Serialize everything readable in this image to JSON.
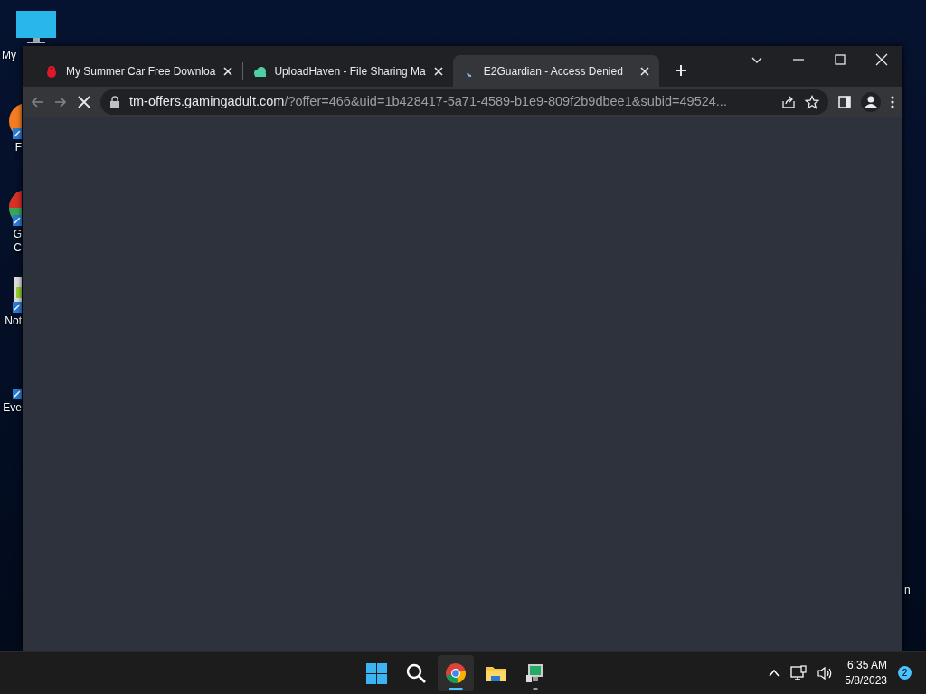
{
  "desktop": {
    "icons": [
      {
        "kind": "monitor",
        "lines": [
          "My"
        ]
      },
      {
        "kind": "orange",
        "lines": [
          "F"
        ]
      },
      {
        "kind": "pie",
        "lines": [
          "G",
          "C"
        ]
      },
      {
        "kind": "notepad",
        "lines": [
          "Not"
        ]
      },
      {
        "kind": "small",
        "lines": [
          "Eve"
        ]
      },
      {
        "kind": "edge",
        "lines": [
          "n"
        ]
      }
    ]
  },
  "browser": {
    "tabs": [
      {
        "title": "My Summer Car Free Downloa",
        "kind": "lock",
        "selected": false,
        "loading": false
      },
      {
        "title": "UploadHaven - File Sharing Ma",
        "kind": "cloud",
        "selected": false,
        "loading": false
      },
      {
        "title": "E2Guardian - Access Denied",
        "selected": true,
        "loading": true
      }
    ],
    "address": {
      "host": "tm-offers.gamingadult.com",
      "path": "/?offer=466&uid=1b428417-5a71-4589-b1e9-809f2b9dbee1&subid=49524..."
    },
    "loading": true
  },
  "taskbar": {
    "apps": [
      {
        "kind": "start",
        "selected": false,
        "running": false
      },
      {
        "kind": "search",
        "selected": false,
        "running": false
      },
      {
        "kind": "chrome",
        "selected": true,
        "running": true
      },
      {
        "kind": "folder",
        "selected": false,
        "running": false
      },
      {
        "kind": "monitor",
        "selected": false,
        "running": true
      }
    ],
    "time": "6:35 AM",
    "date": "5/8/2023",
    "notifications": "2"
  }
}
